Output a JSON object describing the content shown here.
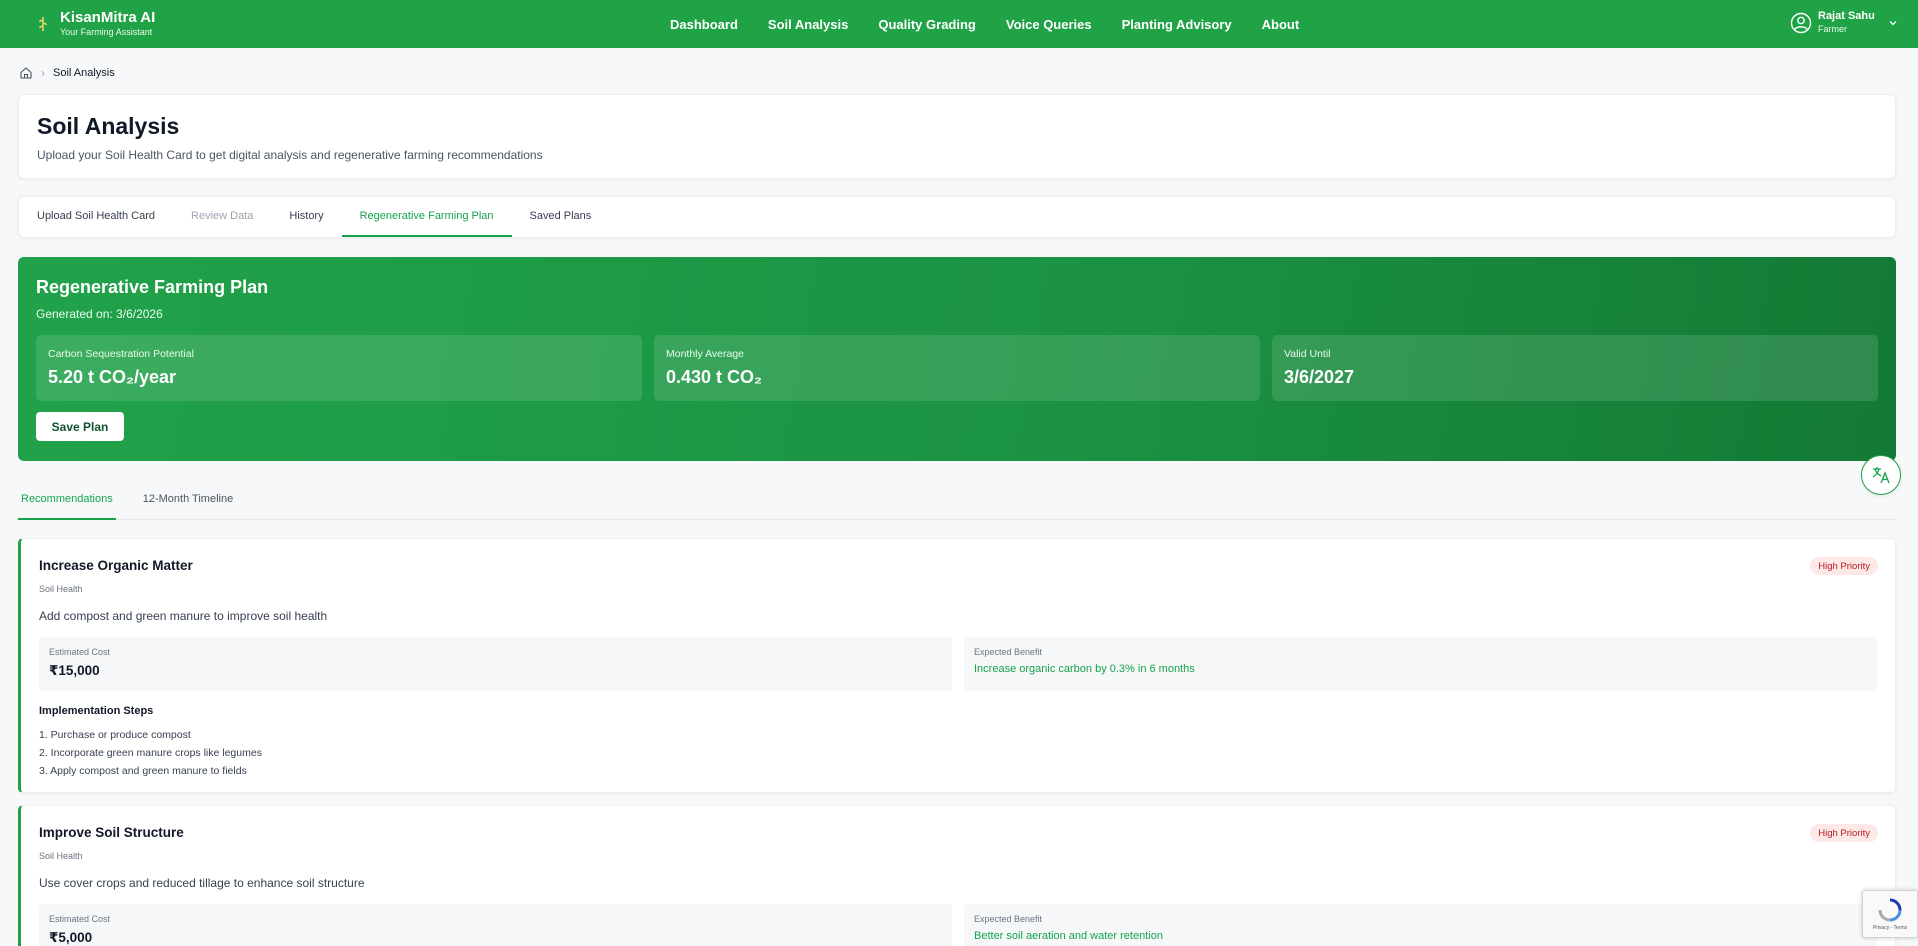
{
  "header": {
    "brand_name": "KisanMitra AI",
    "brand_tagline": "Your Farming Assistant",
    "nav": [
      "Dashboard",
      "Soil Analysis",
      "Quality Grading",
      "Voice Queries",
      "Planting Advisory",
      "About"
    ],
    "user_name": "Rajat Sahu",
    "user_role": "Farmer"
  },
  "breadcrumb": {
    "current": "Soil Analysis"
  },
  "page": {
    "title": "Soil Analysis",
    "subtitle": "Upload your Soil Health Card to get digital analysis and regenerative farming recommendations"
  },
  "tabs": [
    {
      "label": "Upload Soil Health Card",
      "state": "normal"
    },
    {
      "label": "Review Data",
      "state": "disabled"
    },
    {
      "label": "History",
      "state": "normal"
    },
    {
      "label": "Regenerative Farming Plan",
      "state": "active"
    },
    {
      "label": "Saved Plans",
      "state": "normal"
    }
  ],
  "plan": {
    "title": "Regenerative Farming Plan",
    "generated": "Generated on: 3/6/2026",
    "stats": [
      {
        "label": "Carbon Sequestration Potential",
        "value": "5.20 t CO₂/year"
      },
      {
        "label": "Monthly Average",
        "value": "0.430 t CO₂"
      },
      {
        "label": "Valid Until",
        "value": "3/6/2027"
      }
    ],
    "save_label": "Save Plan"
  },
  "subtabs": [
    {
      "label": "Recommendations",
      "active": true
    },
    {
      "label": "12-Month Timeline",
      "active": false
    }
  ],
  "recommendations": [
    {
      "title": "Increase Organic Matter",
      "category": "Soil Health",
      "priority": "High Priority",
      "description": "Add compost and green manure to improve soil health",
      "cost_label": "Estimated Cost",
      "cost": "₹15,000",
      "benefit_label": "Expected Benefit",
      "benefit": "Increase organic carbon by 0.3% in 6 months",
      "steps_title": "Implementation Steps",
      "steps": [
        "1. Purchase or produce compost",
        "2. Incorporate green manure crops like legumes",
        "3. Apply compost and green manure to fields"
      ]
    },
    {
      "title": "Improve Soil Structure",
      "category": "Soil Health",
      "priority": "High Priority",
      "description": "Use cover crops and reduced tillage to enhance soil structure",
      "cost_label": "Estimated Cost",
      "cost": "₹5,000",
      "benefit_label": "Expected Benefit",
      "benefit": "Better soil aeration and water retention"
    }
  ],
  "recaptcha": {
    "text": "Privacy - Terms"
  },
  "colors": {
    "brand_green": "#20a246",
    "priority_red": "#b91c1c"
  },
  "icons": {
    "logo": "wheat-icon",
    "home": "home-icon",
    "user": "user-circle-icon",
    "translate": "translate-icon"
  }
}
